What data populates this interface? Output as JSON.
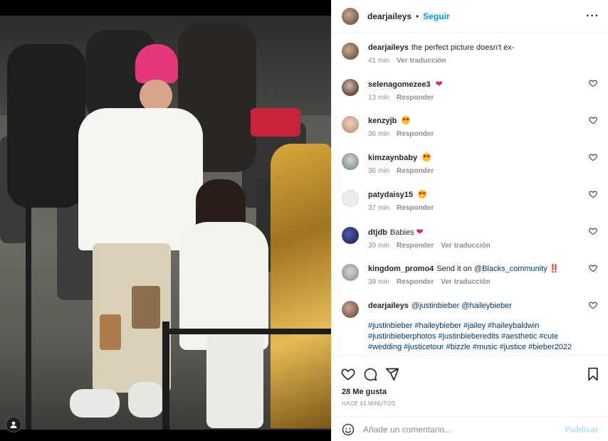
{
  "post": {
    "author": "dearjaileys",
    "separator": "•",
    "follow_label": "Seguir",
    "more_icon": "more-horizontal-icon"
  },
  "comments": [
    {
      "user": "dearjaileys",
      "text": "the perfect picture doesn't ex-",
      "time": "41 min",
      "actions": [
        "Ver traducción"
      ],
      "emoji": "",
      "avatar": "av-a"
    },
    {
      "user": "selenagomezee3",
      "text": "",
      "time": "13 min",
      "actions": [
        "Responder"
      ],
      "emoji": "heart",
      "avatar": "av-b"
    },
    {
      "user": "kenzyjb",
      "text": "",
      "time": "36 min",
      "actions": [
        "Responder"
      ],
      "emoji": "star-struck",
      "avatar": "av-c"
    },
    {
      "user": "kimzaynbaby",
      "text": "",
      "time": "36 min",
      "actions": [
        "Responder"
      ],
      "emoji": "star-struck",
      "avatar": "av-d"
    },
    {
      "user": "patydaisy15",
      "text": "",
      "time": "37 min",
      "actions": [
        "Responder"
      ],
      "emoji": "star-struck",
      "avatar": "av-e"
    },
    {
      "user": "dtjdb",
      "text": "Babies",
      "time": "39 min",
      "actions": [
        "Responder",
        "Ver traducción"
      ],
      "emoji": "heart",
      "avatar": "av-f"
    },
    {
      "user": "kingdom_promo4",
      "text": "Send it on",
      "mention": "@Blacks_community",
      "suffix": "‼️",
      "time": "39 min",
      "actions": [
        "Responder",
        "Ver traducción"
      ],
      "emoji": "",
      "avatar": "av-g"
    },
    {
      "user": "dearjaileys",
      "mentions": [
        "@justinbieber",
        "@haileybieber"
      ],
      "hashtags": "#justinbieber #haileybieber #jailey #haileybaldwin #justinbieberphotos #justinbieberedits #aesthetic #cute #wedding #justicetour #bizzle #music #justice #bieber2022",
      "time": "",
      "actions": [],
      "emoji": "",
      "avatar": "av-a"
    }
  ],
  "actions": {
    "like_icon": "heart-outline-icon",
    "comment_icon": "comment-bubble-icon",
    "share_icon": "paper-plane-icon",
    "save_icon": "bookmark-icon",
    "likes_label": "28 Me gusta",
    "timestamp": "HACE 41 MINUTOS"
  },
  "composer": {
    "emoji_icon": "smiley-icon",
    "placeholder": "Añade un comentario...",
    "publish_label": "Publicar"
  },
  "colors": {
    "accent": "#0095f6",
    "publish_disabled": "#b2dffc",
    "heart": "#e0245e",
    "muted": "#8e8e8e",
    "hashtag": "#00376b"
  }
}
